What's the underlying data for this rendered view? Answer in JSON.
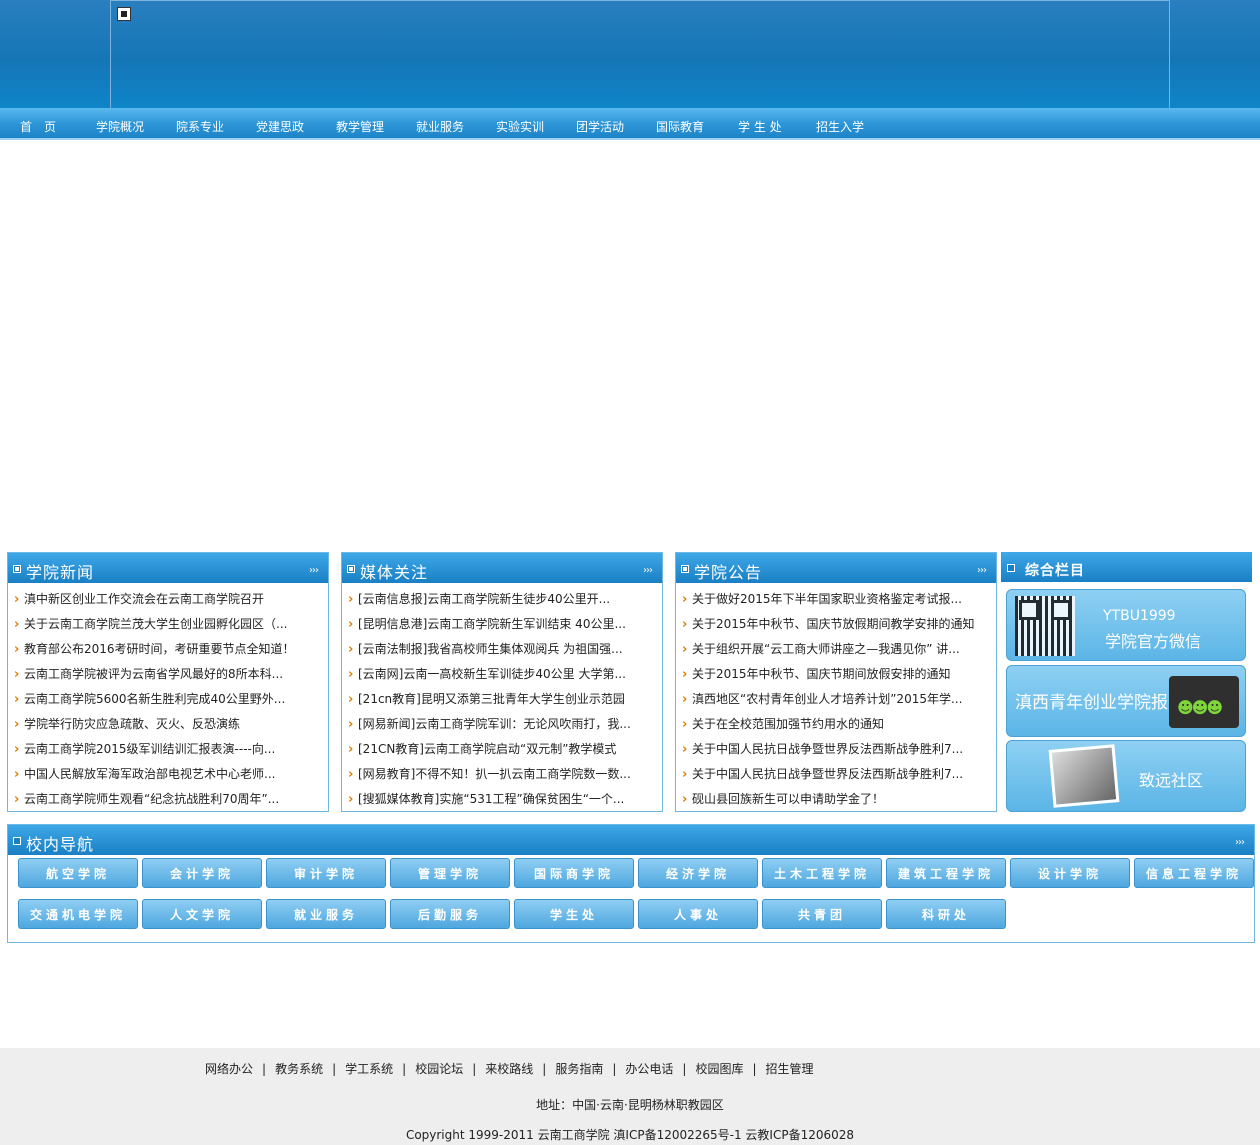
{
  "nav": [
    "首　页",
    "学院概况",
    "院系专业",
    "党建思政",
    "教学管理",
    "就业服务",
    "实验实训",
    "团学活动",
    "国际教育",
    "学 生 处",
    "招生入学"
  ],
  "panels": [
    {
      "title": "学院新闻",
      "more": "›››",
      "items": [
        "滇中新区创业工作交流会在云南工商学院召开",
        "关于云南工商学院兰茂大学生创业园孵化园区（...",
        "教育部公布2016考研时间，考研重要节点全知道！",
        "云南工商学院被评为云南省学风最好的8所本科...",
        "云南工商学院5600名新生胜利完成40公里野外...",
        "学院举行防灾应急疏散、灭火、反恐演练",
        "云南工商学院2015级军训结训汇报表演----向...",
        "中国人民解放军海军政治部电视艺术中心老师...",
        "云南工商学院师生观看“纪念抗战胜利70周年”..."
      ]
    },
    {
      "title": "媒体关注",
      "more": "›››",
      "items": [
        "[云南信息报]云南工商学院新生徒步40公里开...",
        "[昆明信息港]云南工商学院新生军训结束 40公里...",
        "[云南法制报]我省高校师生集体观阅兵 为祖国强...",
        "[云南网]云南一高校新生军训徒步40公里 大学第...",
        "[21cn教育]昆明又添第三批青年大学生创业示范园",
        "[网易新闻]云南工商学院军训：无论风吹雨打，我...",
        "[21CN教育]云南工商学院启动“双元制”教学模式",
        "[网易教育]不得不知！扒一扒云南工商学院数一数...",
        "[搜狐媒体教育]实施“531工程”确保贫困生“一个..."
      ]
    },
    {
      "title": "学院公告",
      "more": "›››",
      "items": [
        "关于做好2015年下半年国家职业资格鉴定考试报...",
        "关于2015年中秋节、国庆节放假期间教学安排的通知",
        "关于组织开展“云工商大师讲座之—我遇见你” 讲...",
        "关于2015年中秋节、国庆节期间放假安排的通知",
        "滇西地区“农村青年创业人才培养计划”2015年学...",
        "关于在全校范围加强节约用水的通知",
        "关于中国人民抗日战争暨世界反法西斯战争胜利7...",
        "关于中国人民抗日战争暨世界反法西斯战争胜利7...",
        "砚山县回族新生可以申请助学金了！"
      ]
    }
  ],
  "side": {
    "title": "综合栏目",
    "wechat_id": "YTBU1999",
    "wechat_label": "学院官方微信",
    "signup_label": "滇西青年创业学院报名入口",
    "community_label": "致远社区"
  },
  "campus": {
    "title": "校内导航",
    "more": "›››",
    "row1": [
      "航空学院",
      "会计学院",
      "审计学院",
      "管理学院",
      "国际商学院",
      "经济学院",
      "土木工程学院",
      "建筑工程学院",
      "设计学院",
      "信息工程学院"
    ],
    "row2": [
      "交通机电学院",
      "人文学院",
      "就业服务",
      "后勤服务",
      "学生处",
      "人事处",
      "共青团",
      "科研处"
    ]
  },
  "footer": {
    "links": [
      "网络办公",
      "教务系统",
      "学工系统",
      "校园论坛",
      "来校路线",
      "服务指南",
      "办公电话",
      "校园图库",
      "招生管理"
    ],
    "address": "地址：中国·云南·昆明杨林职教园区",
    "copyright": "Copyright 1999-2011 云南工商学院 滇ICP备12002265号-1 云教ICP备1206028"
  }
}
